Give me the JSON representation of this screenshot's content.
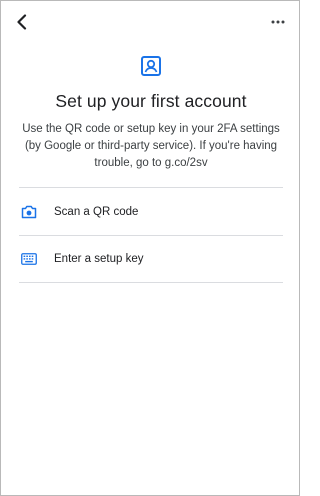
{
  "header": {
    "back_icon": "chevron-left-icon",
    "more_icon": "more-horizontal-icon"
  },
  "hero": {
    "icon": "account-box-icon",
    "accent_color": "#1a73e8",
    "title": "Set up your first account",
    "description": "Use the QR code or setup key in your 2FA settings (by Google or third-party service). If you're having trouble, go to g.co/2sv"
  },
  "options": [
    {
      "icon": "camera-icon",
      "label": "Scan a QR code"
    },
    {
      "icon": "keyboard-icon",
      "label": "Enter a setup key"
    }
  ]
}
